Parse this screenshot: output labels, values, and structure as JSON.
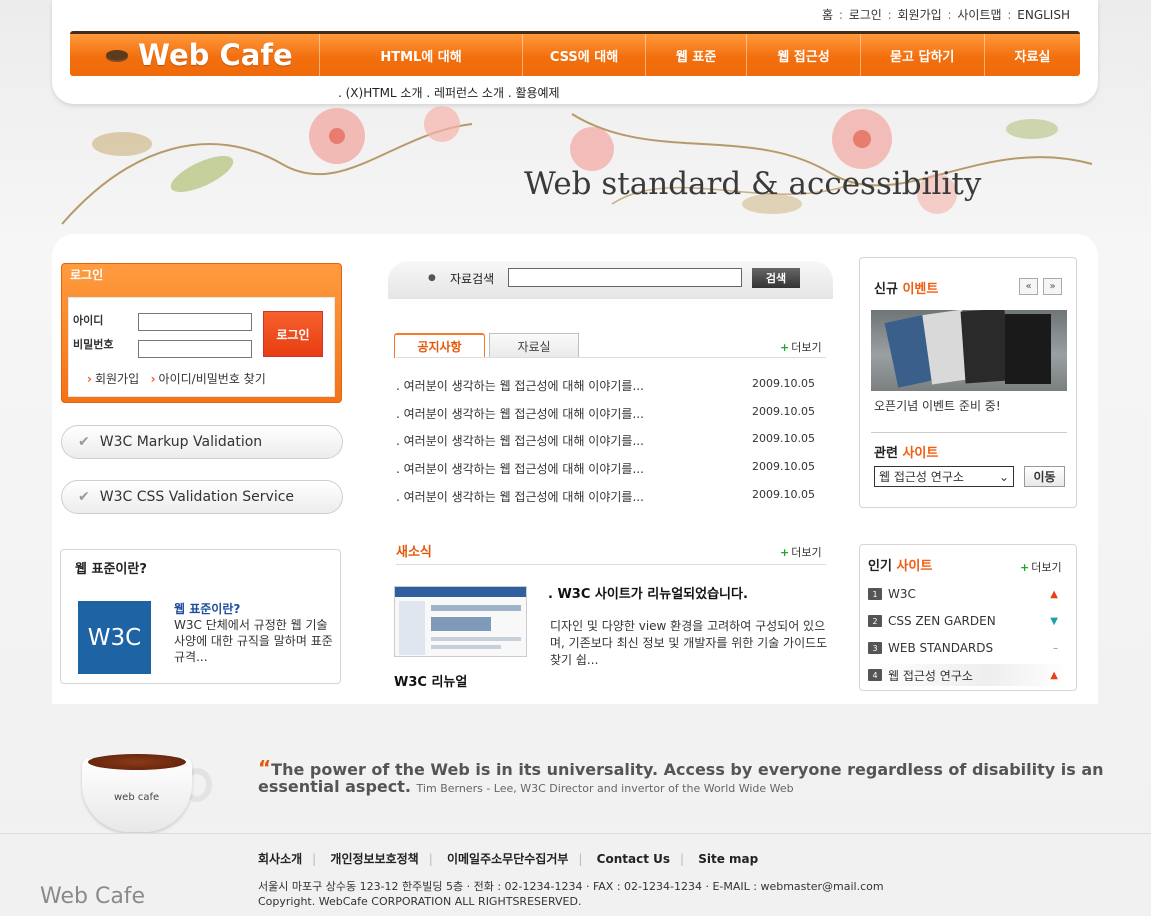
{
  "util_nav": [
    "홈",
    "로그인",
    "회원가입",
    "사이트맵",
    "ENGLISH"
  ],
  "logo": "Web Cafe",
  "gnb": [
    "HTML에 대해",
    "CSS에 대해",
    "웹 표준",
    "웹 접근성",
    "묻고 답하기",
    "자료실"
  ],
  "sub_nav": ". (X)HTML 소개 . 레퍼런스 소개 . 활용예제",
  "hero": {
    "tagline": "Web standard & accessibility"
  },
  "login": {
    "title": "로그인",
    "id_label": "아이디",
    "pw_label": "비밀번호",
    "button": "로그인",
    "join_link": "회원가입",
    "find_link": "아이디/비밀번호 찾기"
  },
  "validation": {
    "markup": "W3C Markup Validation",
    "css": "W3C CSS Validation Service"
  },
  "web_standard": {
    "title": "웹 표준이란?",
    "logo_text": "W3C",
    "subtitle": "웹 표준이란?",
    "description": "W3C 단체에서 규정한 웹 기술 사양에 대한 규직을 말하며 표준 규격..."
  },
  "search": {
    "label": "자료검색",
    "button": "검색"
  },
  "tabs": {
    "notice": "공지사항",
    "library": "자료실",
    "more": "더보기"
  },
  "notices": [
    {
      "title": ". 여러분이 생각하는 웹 접근성에 대해 이야기를...",
      "date": "2009.10.05"
    },
    {
      "title": ". 여러분이 생각하는 웹 접근성에 대해 이야기를...",
      "date": "2009.10.05"
    },
    {
      "title": ". 여러분이 생각하는 웹 접근성에 대해 이야기를...",
      "date": "2009.10.05"
    },
    {
      "title": ". 여러분이 생각하는 웹 접근성에 대해 이야기를...",
      "date": "2009.10.05"
    },
    {
      "title": ". 여러분이 생각하는 웹 접근성에 대해 이야기를...",
      "date": "2009.10.05"
    }
  ],
  "news": {
    "title": "새소식",
    "more": "더보기",
    "headline": ". W3C 사이트가 리뉴얼되었습니다.",
    "description": "디자인 및 다양한 view 환경을 고려하여 구성되어 있으며, 기존보다 최신 정보 및 개발자를 위한 기술 가이드도 찾기 쉽...",
    "thumb_caption": "W3C 리뉴얼"
  },
  "event": {
    "title_a": "신규",
    "title_b": "이벤트",
    "prev": "«",
    "next": "»",
    "text": "오픈기념 이벤트 준비 중!"
  },
  "related": {
    "title_a": "관련",
    "title_b": "사이트",
    "selected": "웹 접근성 연구소",
    "button": "이동"
  },
  "popular": {
    "title_a": "인기",
    "title_b": "사이트",
    "more": "더보기",
    "items": [
      {
        "rank": "1",
        "name": "W3C",
        "trend": "up"
      },
      {
        "rank": "2",
        "name": "CSS ZEN GARDEN",
        "trend": "down"
      },
      {
        "rank": "3",
        "name": "WEB STANDARDS",
        "trend": "same"
      },
      {
        "rank": "4",
        "name": "웹 접근성 연구소",
        "trend": "up"
      }
    ]
  },
  "quote": {
    "mark": "“",
    "text": "The power of the Web is in its universality. Access by everyone regardless of disability is an essential aspect.",
    "author": "Tim Berners - Lee, W3C Director and invertor of the World Wide Web"
  },
  "cup_text": "web cafe",
  "footer": {
    "links": [
      "회사소개",
      "개인정보보호정책",
      "이메일주소무단수집거부",
      "Contact Us",
      "Site map"
    ],
    "address": "서울시 마포구 상수동 123-12 한주빌딩 5층   · 전화 : 02-1234-1234   · FAX : 02-1234-1234   · E-MAIL : webmaster@mail.com",
    "copyright": "Copyright. WebCafe CORPORATION ALL RIGHTSRESERVED.",
    "logo": "Web Cafe"
  },
  "colors": {
    "accent": "#f36f0e",
    "highlight": "#e4580a",
    "trend_up": "#e8401c",
    "trend_down": "#1aa1a8"
  }
}
